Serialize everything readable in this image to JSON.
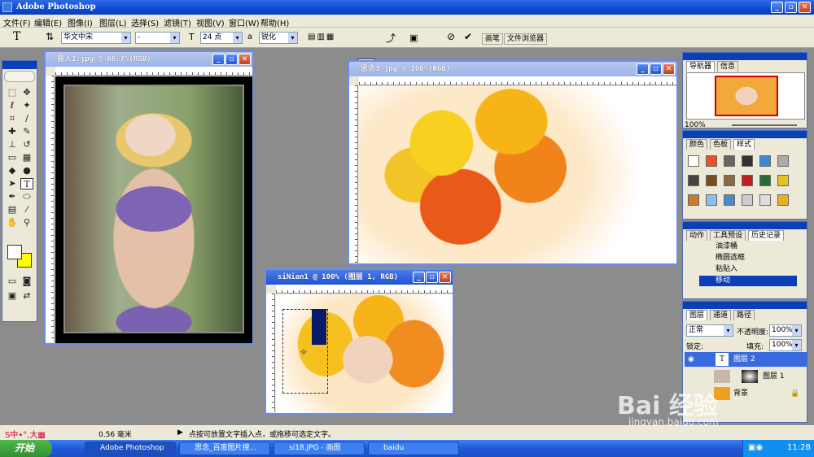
{
  "app": {
    "title": "Adobe Photoshop"
  },
  "menu": [
    "文件(F)",
    "编辑(E)",
    "图像(I)",
    "图层(L)",
    "选择(S)",
    "滤镜(T)",
    "视图(V)",
    "窗口(W)",
    "帮助(H)"
  ],
  "options": {
    "font_family": "华文中宋",
    "font_style": "-",
    "font_size": "24 点",
    "aa_label": "a",
    "antialias": "锐化",
    "tabs": [
      "画笔",
      "文件浏览器"
    ]
  },
  "windows": {
    "doc1": {
      "title": "丽人1.jpg @ 66.7%(RGB)"
    },
    "doc2": {
      "title": "思念3.jpg @ 100%(RGB)"
    },
    "doc3": {
      "title": "siNian1 @ 100% (图层 1, RGB)"
    }
  },
  "navigator": {
    "tabs": [
      "导航器",
      "信息"
    ],
    "zoom": "100%"
  },
  "styles_panel": {
    "tabs": [
      "颜色",
      "色板",
      "样式"
    ]
  },
  "history": {
    "tabs": [
      "动作",
      "工具预设",
      "历史记录"
    ],
    "items": [
      "油漆桶",
      "椭圆选框",
      "粘贴入",
      "移动"
    ]
  },
  "layers": {
    "tabs": [
      "图层",
      "通道",
      "路径"
    ],
    "blend_mode": "正常",
    "opacity_label": "不透明度:",
    "opacity": "100%",
    "lock_label": "锁定:",
    "fill_label": "填充:",
    "fill": "100%",
    "items": [
      "图层 2",
      "图层 1",
      "背景"
    ]
  },
  "status": {
    "zoom": "0.56 毫米",
    "hint": "点按可放置文字插入点，或拖移可选定文字。"
  },
  "taskbar": {
    "start": "开始",
    "buttons": [
      "Adobe Photoshop",
      "思念_百度图片搜...",
      "si18.JPG - 画图",
      "baidu"
    ],
    "clock": "11:28"
  },
  "watermark": {
    "logo": "Bai 经验",
    "url": "jingyan.baidu.com"
  },
  "colors": {
    "accent": "#0a3fb5",
    "fg_swatch": "#ffffff",
    "bg_swatch": "#ffff00"
  }
}
